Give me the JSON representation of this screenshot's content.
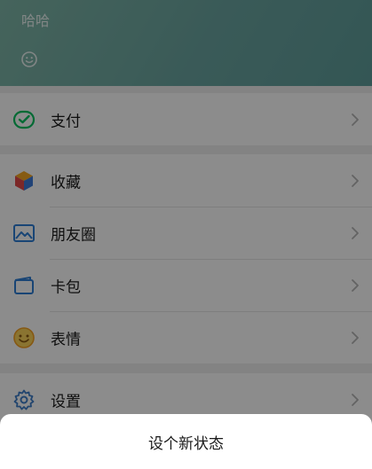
{
  "profile": {
    "name": "哈哈",
    "status_icon": "smile-face-icon"
  },
  "menu": {
    "groups": [
      {
        "items": [
          {
            "label": "支付",
            "icon": "pay-icon"
          }
        ]
      },
      {
        "items": [
          {
            "label": "收藏",
            "icon": "favorites-cube-icon"
          },
          {
            "label": "朋友圈",
            "icon": "moments-image-icon"
          },
          {
            "label": "卡包",
            "icon": "card-wallet-icon"
          },
          {
            "label": "表情",
            "icon": "sticker-smile-icon"
          }
        ]
      },
      {
        "items": [
          {
            "label": "设置",
            "icon": "settings-gear-icon"
          }
        ]
      }
    ]
  },
  "bottom_sheet": {
    "action_label": "设个新状态"
  },
  "colors": {
    "header_gradient_start": "#7fb6a8",
    "header_gradient_end": "#5f9d9b",
    "pay_green": "#07c160",
    "moments_blue": "#2f7fd6",
    "sticker_orange": "#f4a123",
    "settings_blue": "#3f7ec9"
  }
}
